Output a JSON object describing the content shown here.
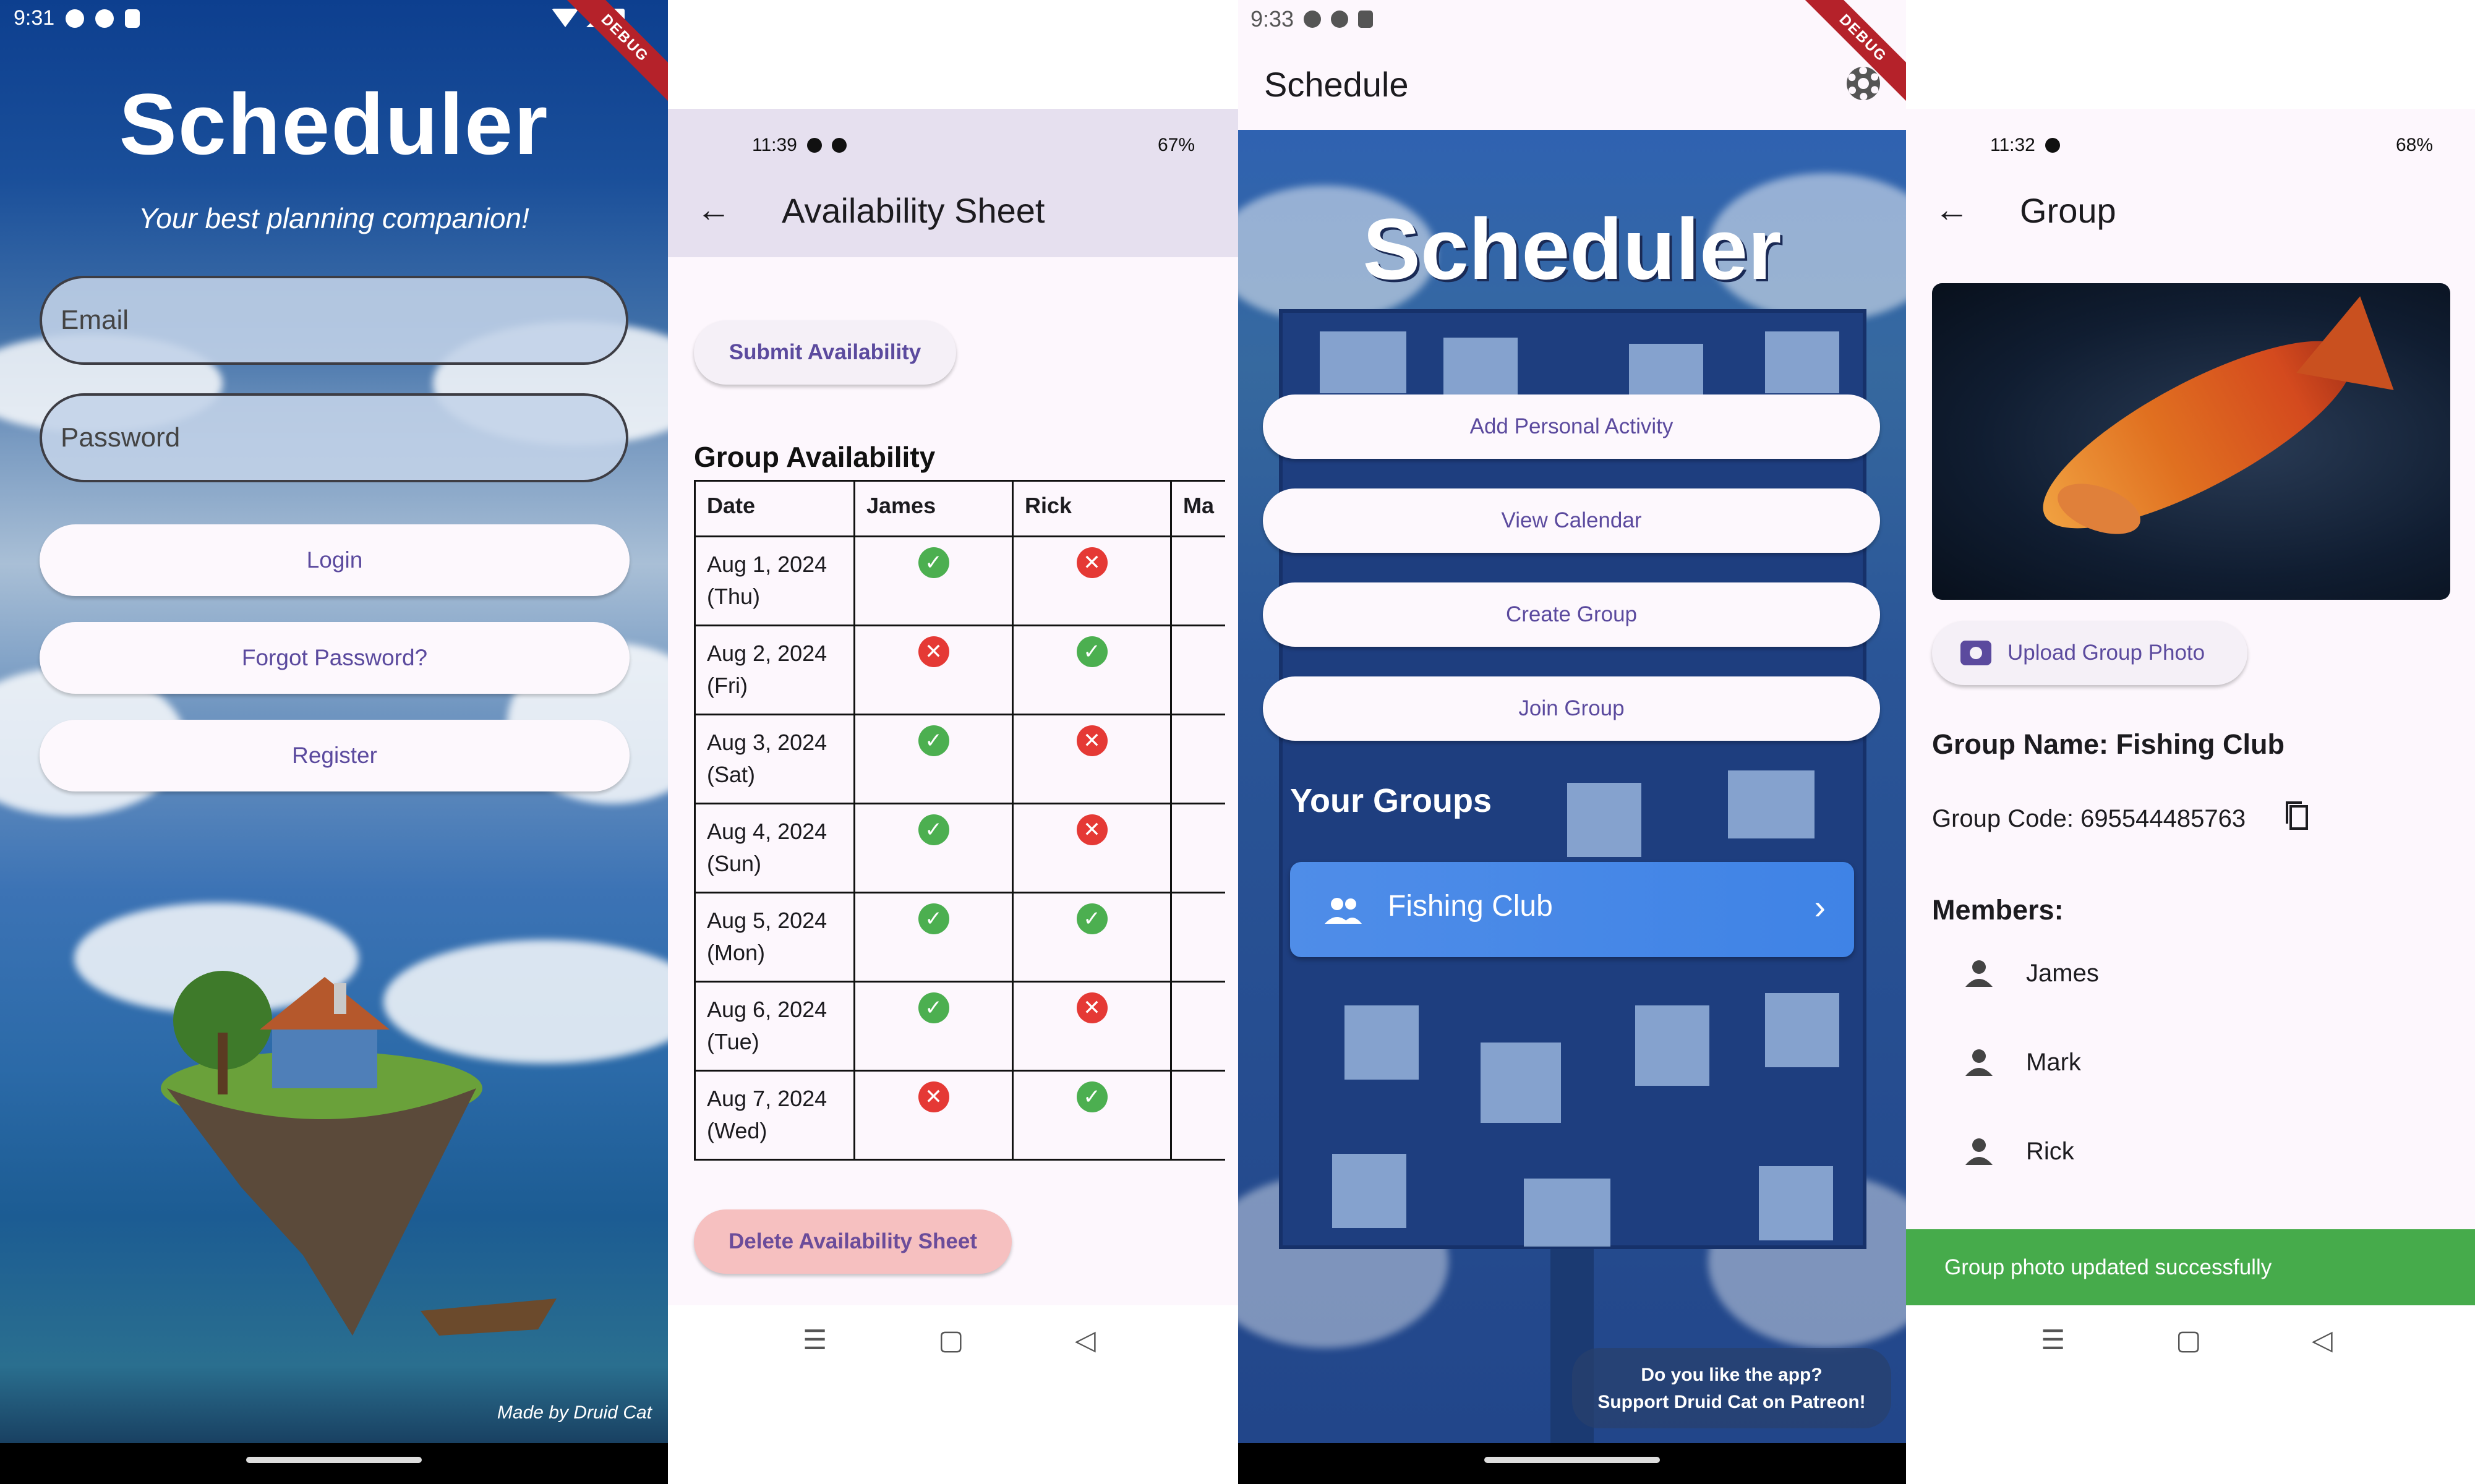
{
  "login": {
    "status_time": "9:31",
    "debug_label": "DEBUG",
    "title": "Scheduler",
    "subtitle": "Your best planning companion!",
    "email_placeholder": "Email",
    "password_placeholder": "Password",
    "login_label": "Login",
    "forgot_label": "Forgot Password?",
    "register_label": "Register",
    "credit": "Made by Druid Cat"
  },
  "availability": {
    "status_time": "11:39",
    "status_right": "67%",
    "title": "Availability Sheet",
    "submit_label": "Submit Availability",
    "heading": "Group Availability",
    "columns": [
      "Date",
      "James",
      "Rick",
      "Ma"
    ],
    "rows": [
      {
        "date": "Aug 1, 2024",
        "day": "(Thu)",
        "james": "yes",
        "rick": "no"
      },
      {
        "date": "Aug 2, 2024",
        "day": "(Fri)",
        "james": "no",
        "rick": "yes"
      },
      {
        "date": "Aug 3, 2024",
        "day": "(Sat)",
        "james": "yes",
        "rick": "no"
      },
      {
        "date": "Aug 4, 2024",
        "day": "(Sun)",
        "james": "yes",
        "rick": "no"
      },
      {
        "date": "Aug 5, 2024",
        "day": "(Mon)",
        "james": "yes",
        "rick": "yes"
      },
      {
        "date": "Aug 6, 2024",
        "day": "(Tue)",
        "james": "yes",
        "rick": "no"
      },
      {
        "date": "Aug 7, 2024",
        "day": "(Wed)",
        "james": "no",
        "rick": "yes"
      }
    ],
    "delete_label": "Delete Availability Sheet"
  },
  "schedule": {
    "status_time": "9:33",
    "debug_label": "DEBUG",
    "appbar_title": "Schedule",
    "hero_title": "Scheduler",
    "buttons": [
      "Add Personal Activity",
      "View Calendar",
      "Create Group",
      "Join Group"
    ],
    "your_groups": "Your Groups",
    "group_name": "Fishing Club",
    "patreon_line1": "Do you like the app?",
    "patreon_line2": "Support Druid Cat on Patreon!"
  },
  "group": {
    "status_time": "11:32",
    "status_right": "68%",
    "title": "Group",
    "upload_label": "Upload Group Photo",
    "name_line": "Group Name: Fishing Club",
    "code_line": "Group Code: 695544485763",
    "members_heading": "Members:",
    "members": [
      "James",
      "Mark",
      "Rick"
    ],
    "snackbar": "Group photo updated successfully"
  },
  "colors": {
    "accent": "#5b4a9e",
    "success": "#46ab4b",
    "ok_icon": "#4caf50",
    "no_icon": "#e53935",
    "group_card": "#3f83e6",
    "danger_button": "#f6c0c0"
  }
}
